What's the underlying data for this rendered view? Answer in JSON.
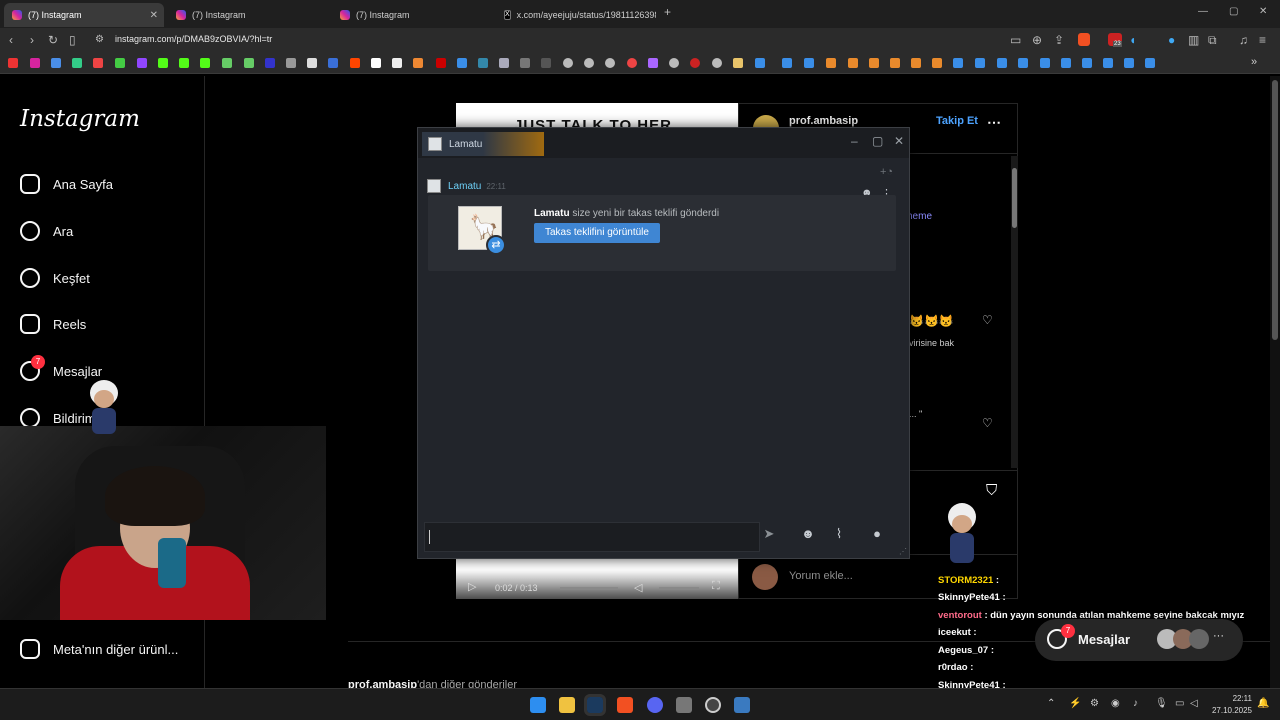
{
  "browser": {
    "tabs": [
      {
        "label": "(7) Instagram",
        "active": true
      },
      {
        "label": "(7) Instagram",
        "active": false
      },
      {
        "label": "(7) Instagram",
        "active": false
      },
      {
        "label": "x.com/ayeejuju/status/19811126398",
        "active": false
      }
    ],
    "new_tab": "+",
    "url": "instagram.com/p/DMAB9zOBVIA/?hl=tr",
    "ext_badge": "23"
  },
  "instagram": {
    "logo": "Instagram",
    "nav": [
      {
        "label": "Ana Sayfa",
        "icon": "home-icon"
      },
      {
        "label": "Ara",
        "icon": "search-icon"
      },
      {
        "label": "Keşfet",
        "icon": "compass-icon"
      },
      {
        "label": "Reels",
        "icon": "reels-icon"
      },
      {
        "label": "Mesajlar",
        "icon": "messenger-icon",
        "badge": "7"
      },
      {
        "label": "Bildirimler",
        "icon": "heart-icon"
      }
    ],
    "more": "Meta'nın diğer ürünl...",
    "post": {
      "image_title": "JUST TALK TO HER",
      "author": "prof.ambasip",
      "follow": "Takip Et",
      "comment_fragment_1": "heme",
      "comment_fragment_2": "virisine bak",
      "comment_fragment_3": "... \"",
      "comment_placeholder": "Yorum ekle...",
      "video_time": "0:02 / 0:13",
      "more_posts_author": "prof.ambasip",
      "more_posts_suffix": "'dan diğer gönderiler"
    },
    "messages_pill": {
      "label": "Mesajlar",
      "badge": "7"
    }
  },
  "steam_chat": {
    "tab_title": "Lamatu",
    "sender": "Lamatu",
    "time": "22:11",
    "message_name": "Lamatu",
    "message_text": " size yeni bir takas teklifi gönderdi",
    "button": "Takas teklifini görüntüle"
  },
  "stream_chat": [
    {
      "user": "STORM2321",
      "text": ":",
      "color": "#ffd700"
    },
    {
      "user": "SkinnyPete41",
      "text": ":",
      "color": "#ffffff"
    },
    {
      "user": "ventorout",
      "text": ": dün yayın sonunda atılan mahkeme şeyine bakcak mıyız",
      "color": "#ff6b8a"
    },
    {
      "user": "iceekut",
      "text": ":",
      "color": "#ffffff"
    },
    {
      "user": "Aegeus_07",
      "text": ":",
      "color": "#ffffff"
    },
    {
      "user": "r0rdao",
      "text": ":",
      "color": "#ffffff"
    },
    {
      "user": "SkinnyPete41",
      "text": ":",
      "color": "#ffffff"
    }
  ],
  "taskbar": {
    "time": "22:11",
    "date": "27.10.2025"
  },
  "colors": {
    "steam_button": "#3f86d3",
    "ig_badge": "#ff3040",
    "ig_link": "#8c8cff"
  }
}
